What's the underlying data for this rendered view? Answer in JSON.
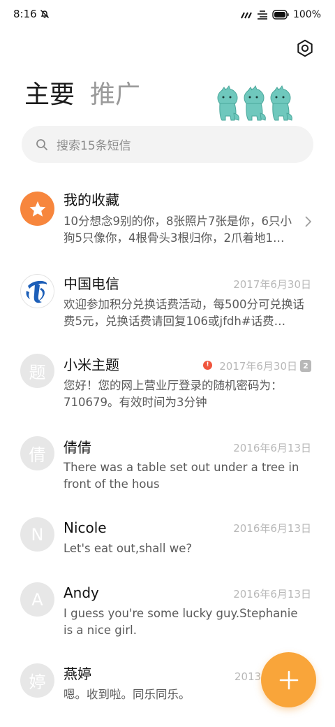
{
  "status_bar": {
    "time": "8:16",
    "battery": "100%"
  },
  "tabs": [
    {
      "label": "主要",
      "active": true
    },
    {
      "label": "推广",
      "active": false
    }
  ],
  "search": {
    "placeholder": "搜索15条短信"
  },
  "conversations": [
    {
      "name": "我的收藏",
      "avatar": "star-icon",
      "preview": "10分想念9别的你，8张照片7张是你，6只小狗5只像你，4根骨头3根归你，2爪着地1…",
      "date": ""
    },
    {
      "name": "中国电信",
      "avatar": "china-telecom-logo",
      "preview": "欢迎参加积分兑换话费活动，每500分可兑换话费5元，兑换话费请回复106或jfdh#话费…",
      "date": "2017年6月30日"
    },
    {
      "name": "小米主题",
      "avatar_letter": "题",
      "preview": "您好！您的网上营业厅登录的随机密码为：710679。有效时间为3分钟",
      "date": "2017年6月30日",
      "error": "!",
      "sim": "2"
    },
    {
      "name": "倩倩",
      "avatar_letter": "倩",
      "preview": "There was a table set out under a tree in front of the hous",
      "date": "2016年6月13日"
    },
    {
      "name": "Nicole",
      "avatar_letter": "N",
      "preview": "Let's eat out,shall we?",
      "date": "2016年6月13日"
    },
    {
      "name": "Andy",
      "avatar_letter": "A",
      "preview": "I guess you're some lucky guy.Stephanie is a nice girl.",
      "date": "2016年6月13日"
    },
    {
      "name": "燕婷",
      "avatar_letter": "婷",
      "preview": "嗯。收到啦。同乐同乐。",
      "date": "2013年"
    }
  ],
  "colors": {
    "accent_orange": "#f9a53a",
    "favorites_orange": "#f7863d",
    "error_red": "#f0553d",
    "telecom_blue": "#1d5fb8"
  }
}
